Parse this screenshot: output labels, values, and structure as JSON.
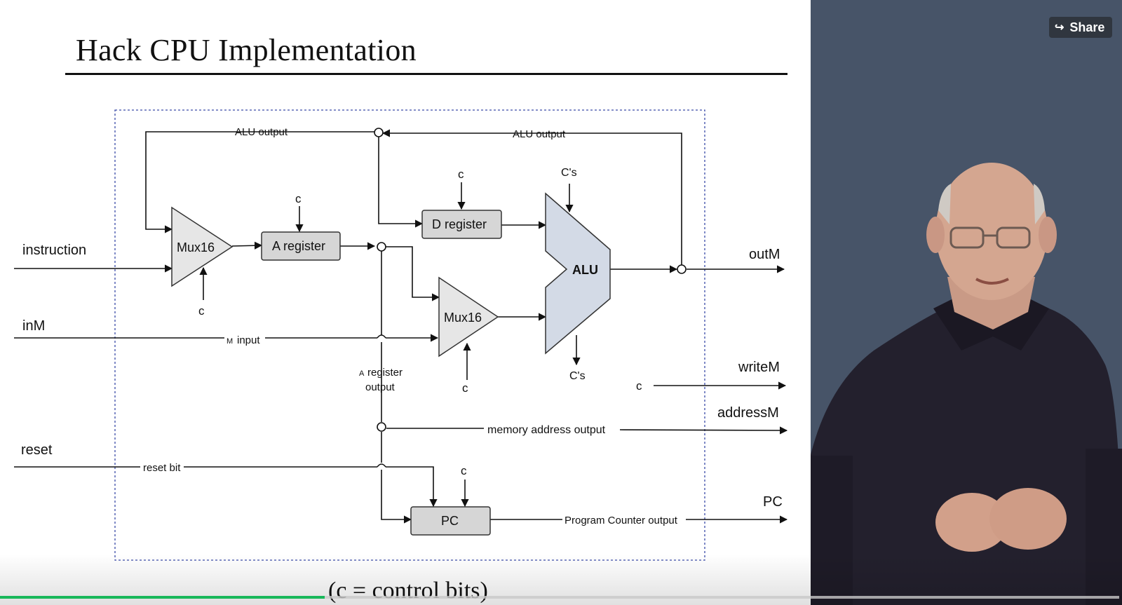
{
  "slide": {
    "title": "Hack CPU Implementation",
    "footer_note": "(c = control bits)"
  },
  "diagram": {
    "inputs": {
      "instruction": "instruction",
      "inM": "inM",
      "reset": "reset"
    },
    "outputs": {
      "outM": "outM",
      "writeM": "writeM",
      "addressM": "addressM",
      "PC": "PC"
    },
    "components": {
      "mux16_a": "Mux16",
      "a_register": "A register",
      "d_register": "D register",
      "mux16_b": "Mux16",
      "alu": "ALU",
      "pc": "PC"
    },
    "wire_labels": {
      "alu_output_left": "ALU output",
      "alu_output_right": "ALU output",
      "m_input_prefix": "M",
      "m_input": "input",
      "a_register_output_prefix": "A",
      "a_register_output_line1": "register",
      "a_register_output_line2": "output",
      "memory_address_output": "memory address output",
      "reset_bit": "reset bit",
      "program_counter_output": "Program Counter output"
    },
    "control_labels": {
      "c": "c",
      "cs": "C's"
    }
  },
  "player": {
    "share_label": "Share",
    "share_icon": "share-icon",
    "progress": 0.29
  }
}
